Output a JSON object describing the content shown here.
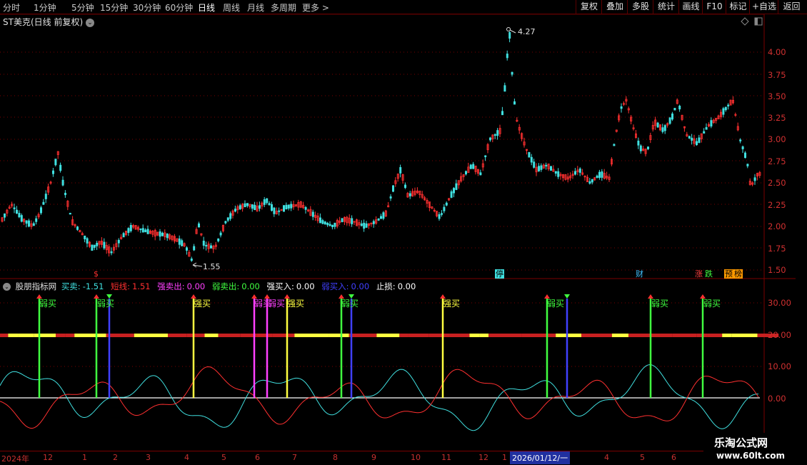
{
  "toolbar": {
    "periods": [
      "分时",
      "1分钟",
      "5分钟",
      "15分钟",
      "30分钟",
      "60分钟",
      "日线",
      "周线",
      "月线",
      "多周期",
      "更多 >"
    ],
    "active_period": "日线",
    "buttons": [
      "复权",
      "叠加",
      "多股",
      "统计",
      "画线",
      "F10",
      "标记",
      "+自选",
      "返回"
    ]
  },
  "price_chart": {
    "title": "ST美克(日线 前复权)",
    "high_marker": "4.27",
    "low_marker": "1.55",
    "y_ticks": [
      "4.00",
      "3.75",
      "3.50",
      "3.25",
      "3.00",
      "2.75",
      "2.50",
      "2.25",
      "2.00",
      "1.75",
      "1.50"
    ],
    "events": [
      {
        "label": "$",
        "color": "#ff3030"
      },
      {
        "label": "停",
        "color": "#40e0e0"
      },
      {
        "label": "财",
        "color": "#40c0ff"
      },
      {
        "label": "涨",
        "color": "#ff4040"
      },
      {
        "label": "跌",
        "color": "#40ff40"
      },
      {
        "label": "预",
        "color": "#ff9900"
      },
      {
        "label": "榜",
        "color": "#ff9900"
      }
    ]
  },
  "indicator": {
    "name": "股朋指标网",
    "fields": [
      {
        "label": "买卖:",
        "value": "-1.51",
        "color": "#40e0e0"
      },
      {
        "label": "短线:",
        "value": "1.51",
        "color": "#ff3030"
      },
      {
        "label": "强卖出:",
        "value": "0.00",
        "color": "#ff40ff"
      },
      {
        "label": "弱卖出:",
        "value": "0.00",
        "color": "#40ff40"
      },
      {
        "label": "强买入:",
        "value": "0.00",
        "color": "#ffffff"
      },
      {
        "label": "弱买入:",
        "value": "0.00",
        "color": "#4040ff"
      },
      {
        "label": "止损:",
        "value": "0.00",
        "color": "#ffffff"
      }
    ],
    "y_ticks": [
      "30.00",
      "20.00",
      "10.00",
      "0.00"
    ],
    "signals": [
      {
        "label": "弱买",
        "color": "#40ff40",
        "arrow": "up"
      },
      {
        "label": "弱买",
        "color": "#40ff40",
        "arrow": "up"
      },
      {
        "label": "",
        "color": "#4040ff",
        "arrow": "down"
      },
      {
        "label": "强买",
        "color": "#ffff40",
        "arrow": "up"
      },
      {
        "label": "弱买",
        "color": "#ff40ff",
        "arrow": "up"
      },
      {
        "label": "弱买",
        "color": "#ff40ff",
        "arrow": "up"
      },
      {
        "label": "强买",
        "color": "#ffff40",
        "arrow": "up"
      },
      {
        "label": "弱买",
        "color": "#40ff40",
        "arrow": "up"
      },
      {
        "label": "",
        "color": "#4040ff",
        "arrow": "down"
      },
      {
        "label": "强买",
        "color": "#ffff40",
        "arrow": "up"
      },
      {
        "label": "弱买",
        "color": "#40ff40",
        "arrow": "up"
      },
      {
        "label": "",
        "color": "#4040ff",
        "arrow": "down"
      },
      {
        "label": "弱买",
        "color": "#40ff40",
        "arrow": "up"
      },
      {
        "label": "弱买",
        "color": "#40ff40",
        "arrow": "up"
      }
    ]
  },
  "time_axis": {
    "labels": [
      "2024年",
      "12",
      "1",
      "2",
      "3",
      "4",
      "5",
      "6",
      "7",
      "8",
      "9",
      "10",
      "11",
      "12",
      "1",
      "2026/01/12/一",
      "4",
      "5",
      "6"
    ]
  },
  "watermark": {
    "line1": "乐淘公式网",
    "line2": "www.60lt.com"
  },
  "colors": {
    "up": "#ff3030",
    "down": "#40e0e0",
    "grid": "#7a0000",
    "axis": "#d03030"
  }
}
